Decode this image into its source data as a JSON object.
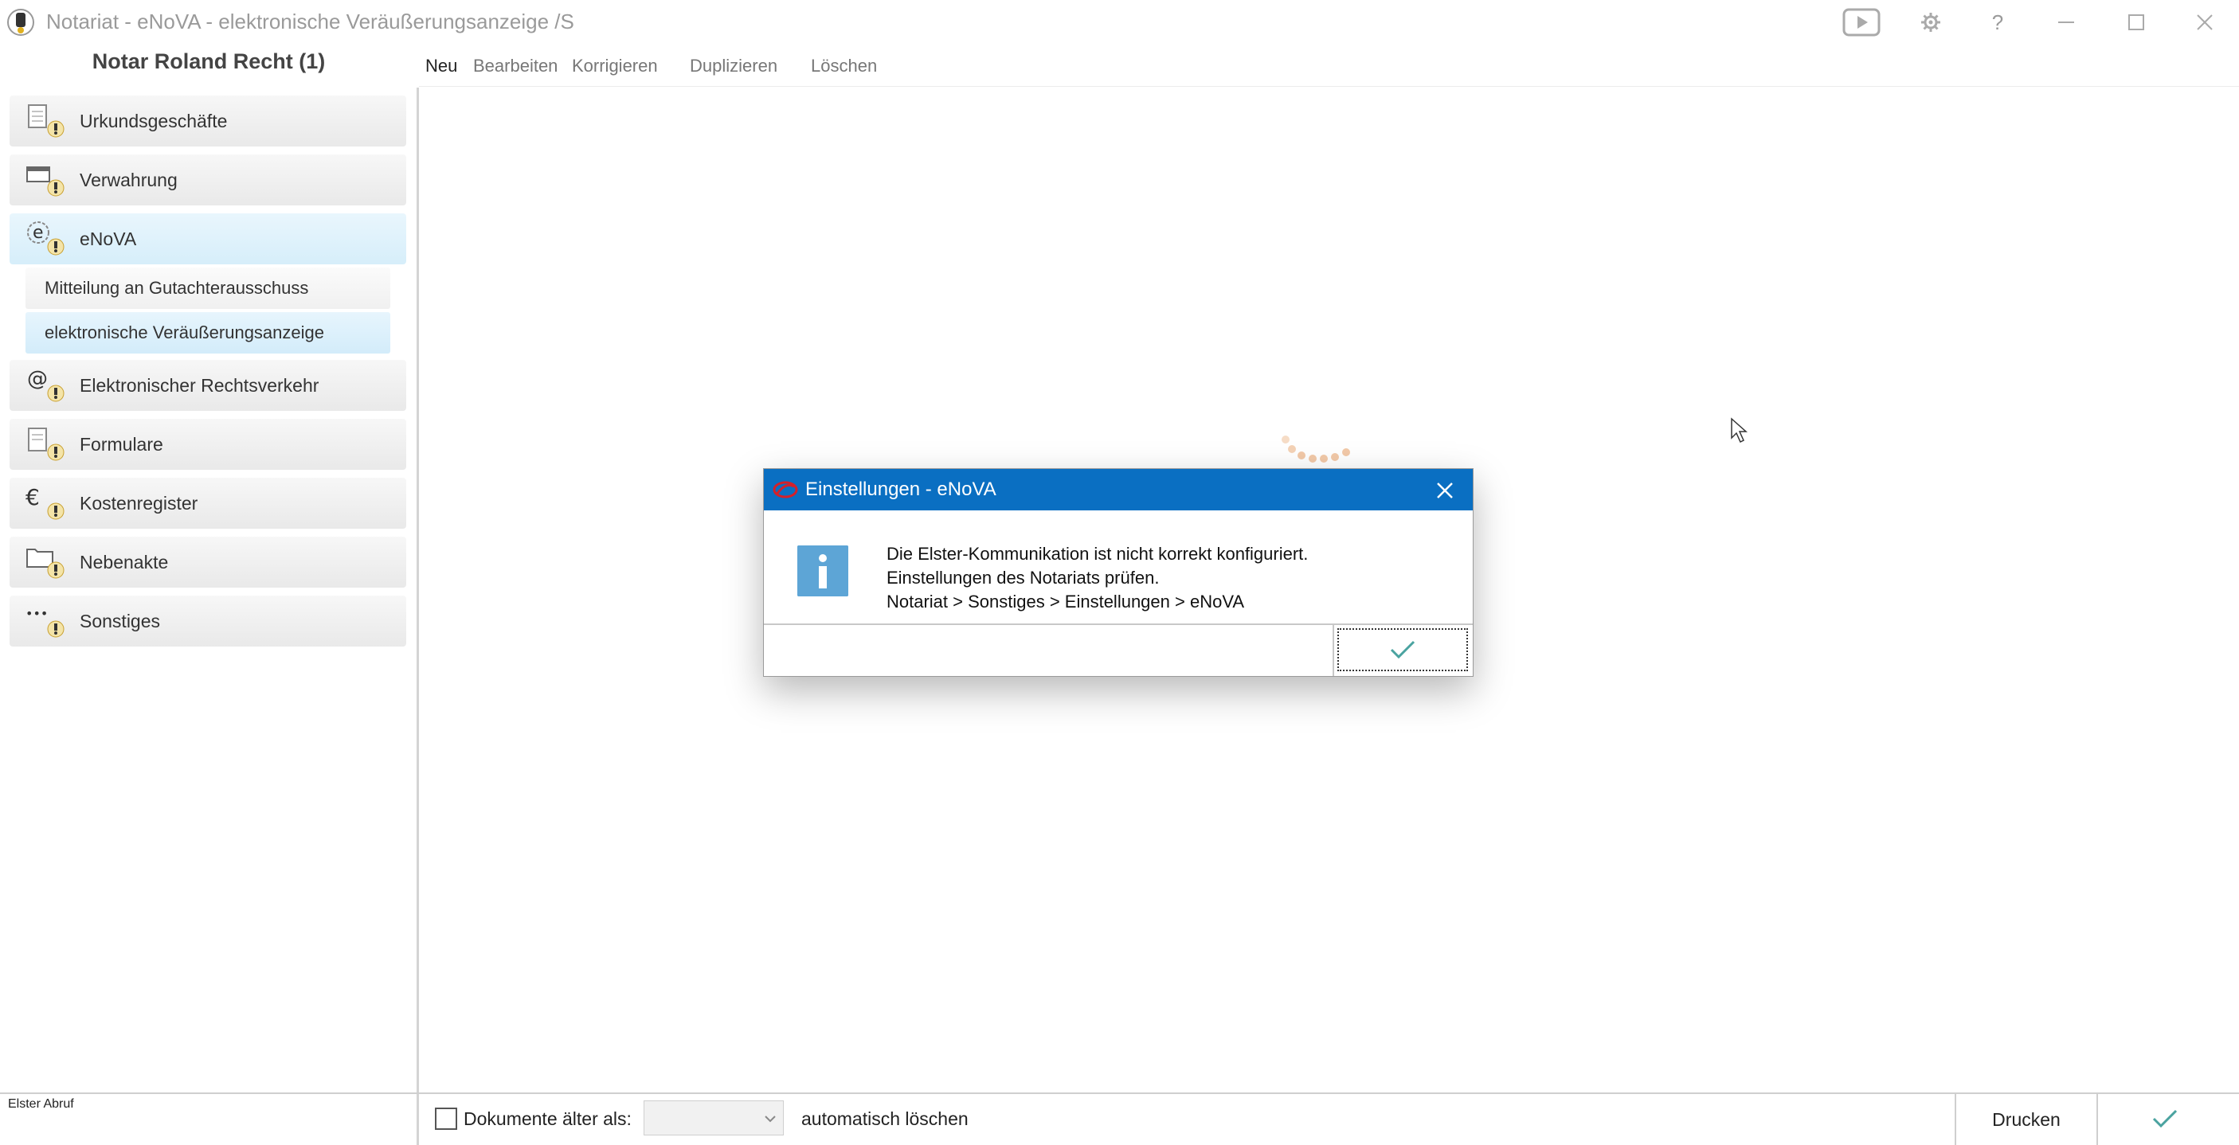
{
  "window": {
    "title": "Notariat - eNoVA - elektronische Veräußerungsanzeige /S",
    "controls": [
      "play-icon",
      "gear-icon",
      "help-icon",
      "minimize-icon",
      "maximize-icon",
      "close-icon"
    ],
    "help_glyph": "?"
  },
  "header": {
    "user_title": "Notar Roland Recht (1)",
    "menu": [
      {
        "label": "Neu",
        "active": true
      },
      {
        "label": "Bearbeiten",
        "active": false
      },
      {
        "label": "Korrigieren",
        "active": false
      },
      {
        "label": "Duplizieren",
        "active": false
      },
      {
        "label": "Löschen",
        "active": false
      }
    ]
  },
  "sidebar": {
    "items": [
      {
        "label": "Urkundsgeschäfte",
        "icon": "document-icon",
        "selected": false
      },
      {
        "label": "Verwahrung",
        "icon": "safe-icon",
        "selected": false
      },
      {
        "label": "eNoVA",
        "icon": "enova-icon",
        "selected": true,
        "subitems": [
          {
            "label": "Mitteilung an Gutachterausschuss",
            "selected": false
          },
          {
            "label": "elektronische Veräußerungsanzeige",
            "selected": true
          }
        ]
      },
      {
        "label": "Elektronischer Rechtsverkehr",
        "icon": "at-icon",
        "selected": false
      },
      {
        "label": "Formulare",
        "icon": "form-icon",
        "selected": false
      },
      {
        "label": "Kostenregister",
        "icon": "euro-icon",
        "selected": false
      },
      {
        "label": "Nebenakte",
        "icon": "folder-icon",
        "selected": false
      },
      {
        "label": "Sonstiges",
        "icon": "more-icon",
        "selected": false
      }
    ],
    "icon_glyphs": {
      "enova": "e",
      "at": "@",
      "euro": "€",
      "more": "•••"
    }
  },
  "dialog": {
    "title": "Einstellungen - eNoVA",
    "message_lines": [
      "Die Elster-Kommunikation ist nicht korrekt konfiguriert.",
      "Einstellungen des Notariats prüfen.",
      "Notariat > Sonstiges > Einstellungen > eNoVA"
    ],
    "icon": "info-icon",
    "ok_icon": "checkmark-icon"
  },
  "footer": {
    "status": "Elster Abruf",
    "checkbox_label": "Dokumente älter als:",
    "checkbox_checked": false,
    "dropdown_value": "",
    "auto_delete_label": "automatisch löschen",
    "print_label": "Drucken",
    "confirm_icon": "checkmark-icon"
  },
  "colors": {
    "dialog_titlebar": "#0a6fc2",
    "selection": "#d6eefa",
    "spinner": "#f2c9a8",
    "checkmark": "#4aa3a0"
  }
}
